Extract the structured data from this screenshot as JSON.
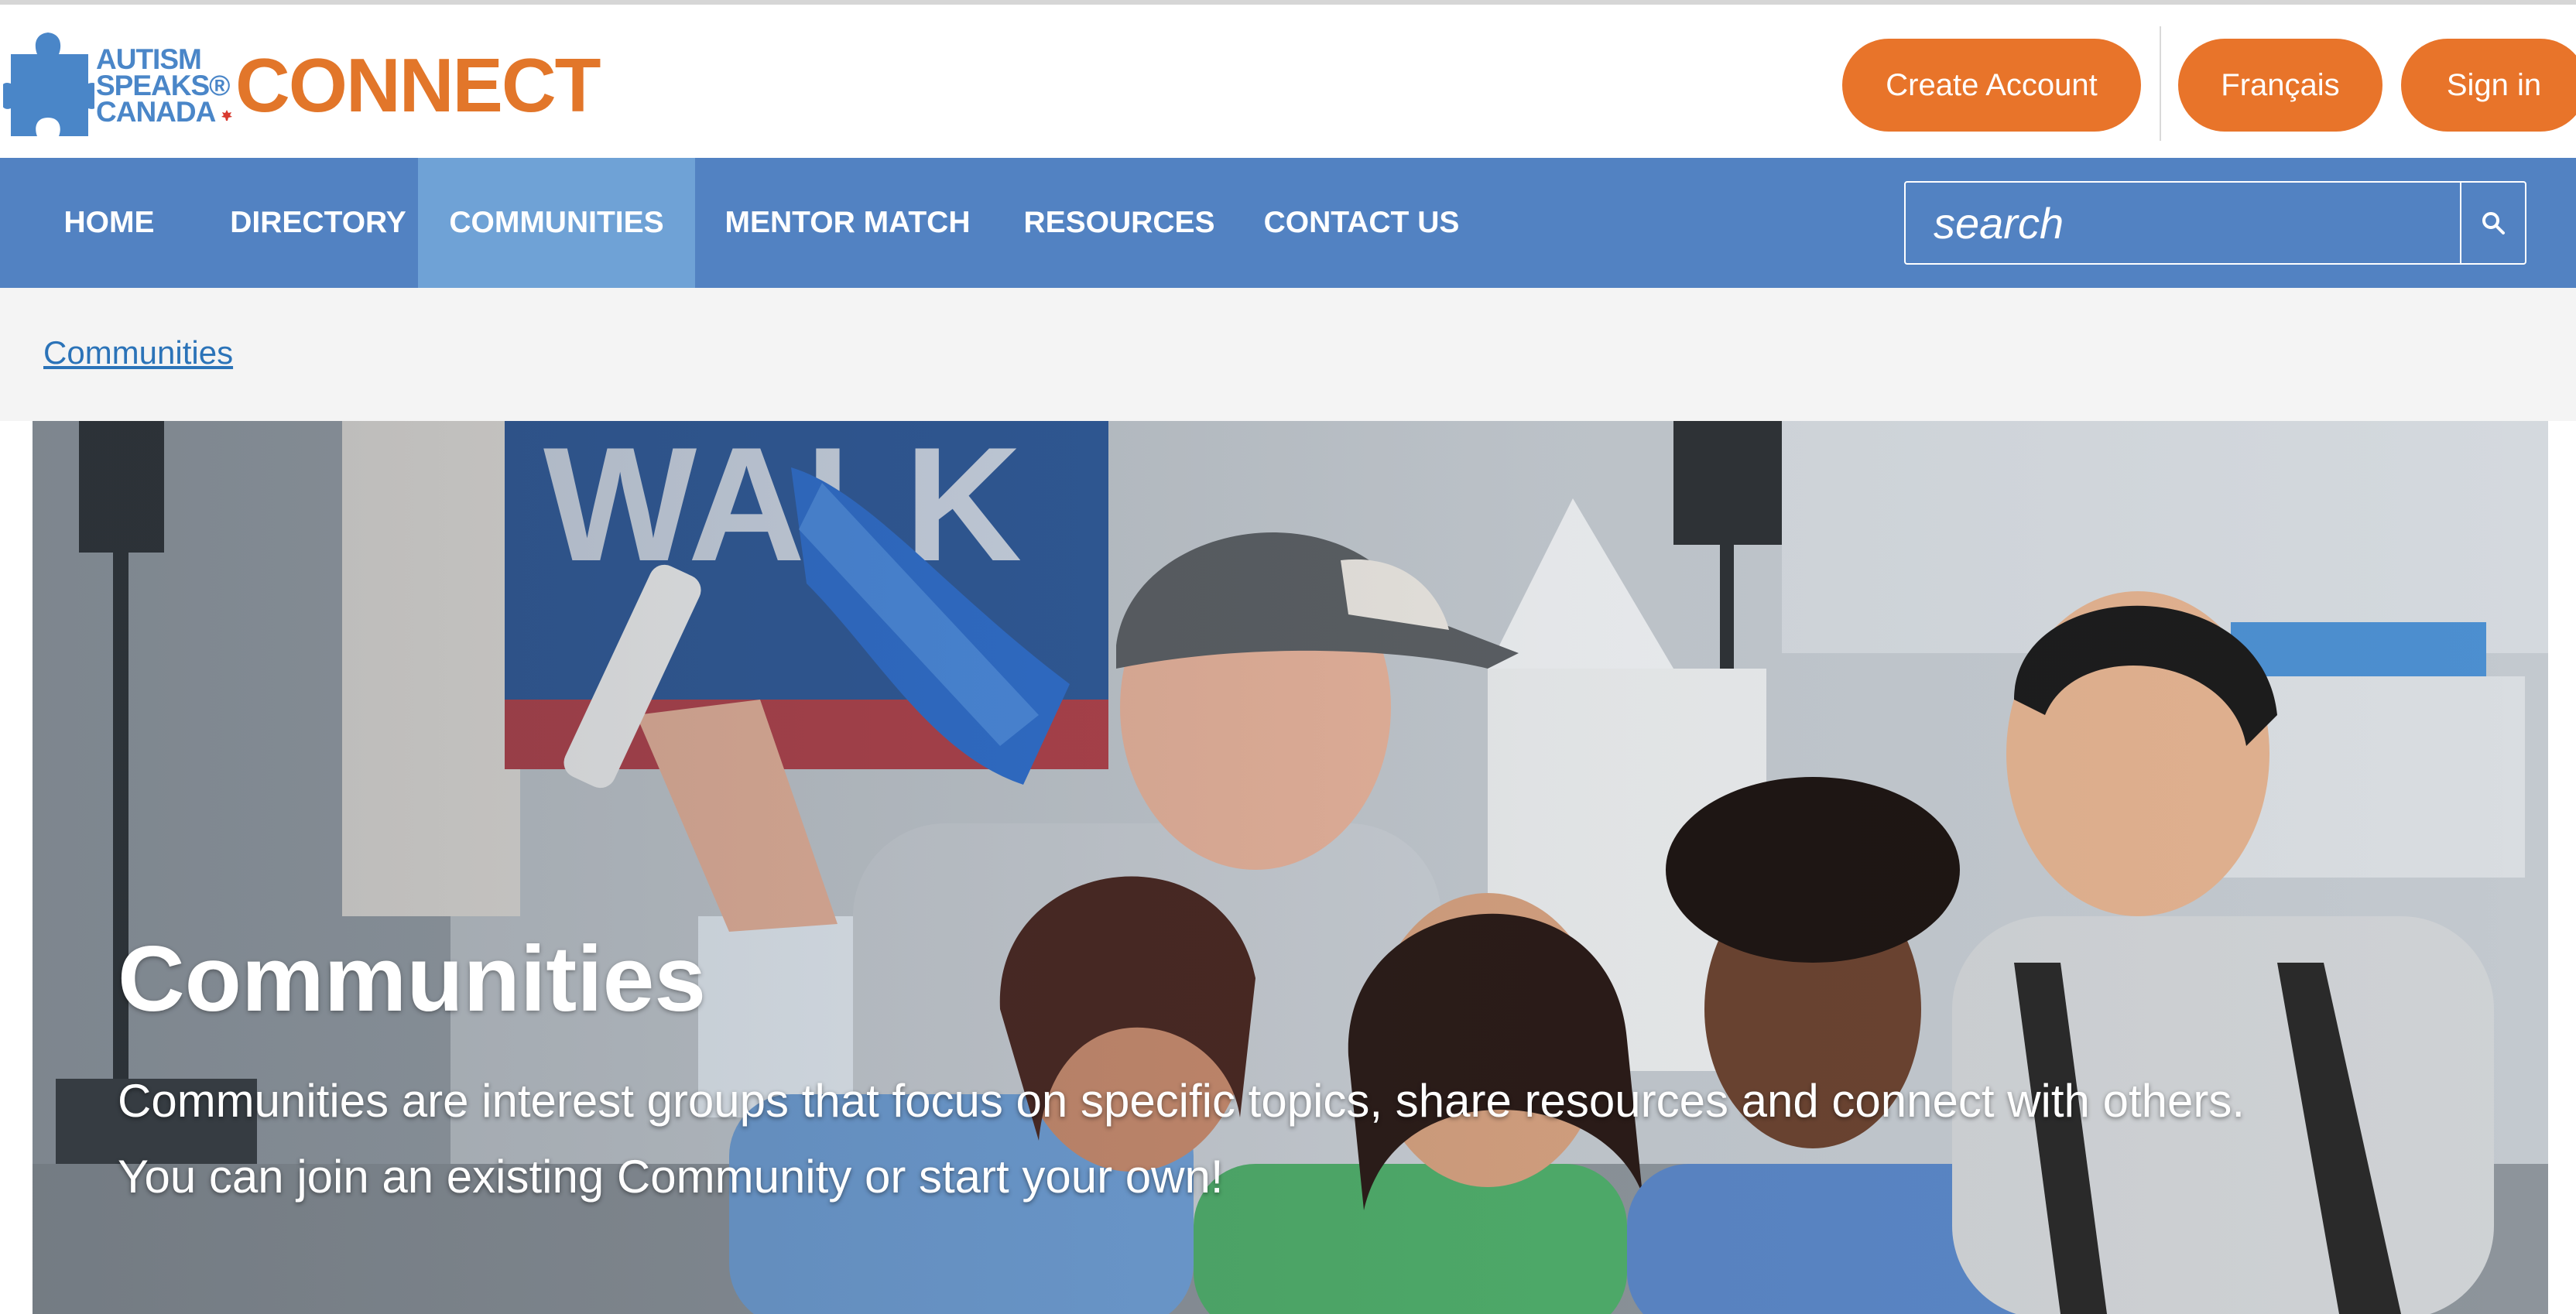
{
  "header": {
    "logo": {
      "line1": "AUTISM",
      "line2": "SPEAKS®",
      "line3": "CANADA",
      "connect": "CONNECT"
    },
    "create_account_label": "Create Account",
    "language_label": "Français",
    "sign_in_label": "Sign in"
  },
  "nav": {
    "items": [
      {
        "label": "HOME"
      },
      {
        "label": "DIRECTORY"
      },
      {
        "label": "COMMUNITIES",
        "active": true
      },
      {
        "label": "MENTOR MATCH"
      },
      {
        "label": "RESOURCES"
      },
      {
        "label": "CONTACT US"
      }
    ],
    "search": {
      "placeholder": "search",
      "icon": "search-icon"
    }
  },
  "breadcrumb": {
    "label": "Communities"
  },
  "hero": {
    "title": "Communities",
    "description_line1": "Communities are interest groups that focus on specific topics, share resources and connect with others.",
    "description_line2": "You can join an existing Community or start your own!"
  },
  "colors": {
    "brand_orange": "#e8742a",
    "nav_blue": "#5282c2",
    "nav_active": "#6fa2d6",
    "logo_blue": "#4a86c8",
    "link_blue": "#2b73b8"
  }
}
